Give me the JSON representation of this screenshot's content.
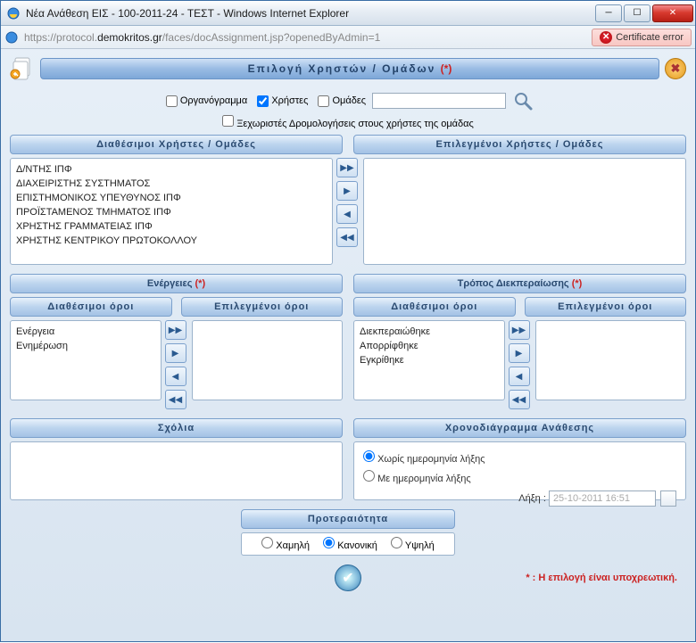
{
  "window": {
    "title": "Νέα Ανάθεση ΕΙΣ - 100-2011-24 - ΤΕΣΤ - Windows Internet Explorer"
  },
  "address": {
    "scheme": "https://",
    "sub": "protocol.",
    "host": "demokritos.gr",
    "path": "/faces/docAssignment.jsp?openedByAdmin=1",
    "cert_error": "Certificate error"
  },
  "main_title": "Επιλογή Χρηστών / Ομάδων",
  "req_marker": "(*)",
  "filters": {
    "org": "Οργανόγραμμα",
    "users": "Χρήστες",
    "groups": "Ομάδες",
    "search_value": ""
  },
  "separate_routing": "Ξεχωριστές Δρομολογήσεις στους χρήστες της ομάδας",
  "avail_users_hdr": "Διαθέσιμοι Χρήστες / Ομάδες",
  "sel_users_hdr": "Επιλεγμένοι Χρήστες / Ομάδες",
  "avail_users": {
    "0": "Δ/ΝΤΗΣ ΙΠΦ",
    "1": "ΔΙΑΧΕΙΡΙΣΤΗΣ ΣΥΣΤΗΜΑΤΟΣ",
    "2": "ΕΠΙΣΤΗΜΟΝΙΚΟΣ ΥΠΕΥΘΥΝΟΣ ΙΠΦ",
    "3": "ΠΡΟΪΣΤΑΜΕΝΟΣ ΤΜΗΜΑΤΟΣ ΙΠΦ",
    "4": "ΧΡΗΣΤΗΣ ΓΡΑΜΜΑΤΕΙΑΣ ΙΠΦ",
    "5": "ΧΡΗΣΤΗΣ ΚΕΝΤΡΙΚΟΥ ΠΡΩΤΟΚΟΛΛΟΥ"
  },
  "actions_hdr": "Ενέργειες",
  "method_hdr": "Τρόπος Διεκπεραίωσης",
  "avail_terms_hdr": "Διαθέσιμοι όροι",
  "sel_terms_hdr": "Επιλεγμένοι όροι",
  "actions": {
    "0": "Ενέργεια",
    "1": "Ενημέρωση"
  },
  "methods": {
    "0": "Διεκπεραιώθηκε",
    "1": "Απορρίφθηκε",
    "2": "Εγκρίθηκε"
  },
  "comments_hdr": "Σχόλια",
  "schedule_hdr": "Χρονοδιάγραμμα Ανάθεσης",
  "schedule": {
    "no_date": "Χωρίς ημερομηνία λήξης",
    "with_date": "Με ημερομηνία λήξης",
    "expiry_label": "Λήξη :",
    "expiry_value": "25-10-2011 16:51"
  },
  "priority_hdr": "Προτεραιότητα",
  "priority": {
    "low": "Χαμηλή",
    "normal": "Κανονική",
    "high": "Υψηλή"
  },
  "footer_note": "* : Η επιλογή είναι υποχρεωτική."
}
